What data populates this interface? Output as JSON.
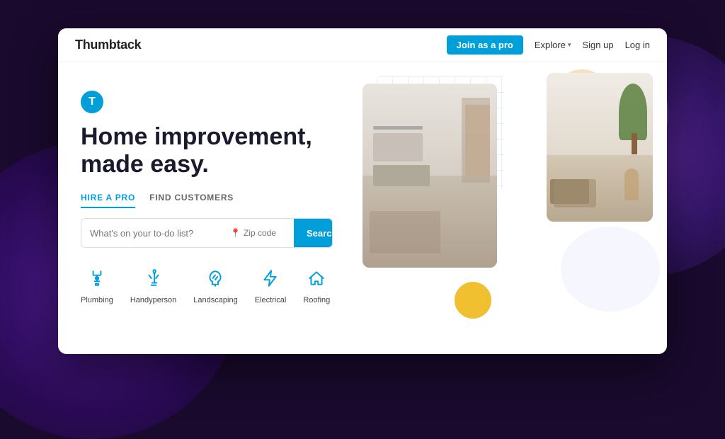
{
  "background": {
    "color": "#1a0a2e"
  },
  "navbar": {
    "logo": "Thumbtack",
    "join_button": "Join as a pro",
    "explore_label": "Explore",
    "signup_label": "Sign up",
    "login_label": "Log in"
  },
  "hero": {
    "logo_letter": "T",
    "headline_line1": "Home improvement,",
    "headline_line2": "made easy.",
    "tab_hire": "HIRE A PRO",
    "tab_find": "FIND CUSTOMERS",
    "search_placeholder": "What's on your to-do list?",
    "zip_placeholder": "Zip code",
    "search_button": "Search"
  },
  "categories": [
    {
      "label": "Plumbing",
      "icon": "plumbing-icon"
    },
    {
      "label": "Handyperson",
      "icon": "handyperson-icon"
    },
    {
      "label": "Landscaping",
      "icon": "landscaping-icon"
    },
    {
      "label": "Electrical",
      "icon": "electrical-icon"
    },
    {
      "label": "Roofing",
      "icon": "roofing-icon"
    }
  ],
  "colors": {
    "brand_blue": "#009fd9",
    "dark_bg": "#1a0a2e",
    "yellow_circle": "#f0c030",
    "peach_circle": "#f5e0c0"
  }
}
